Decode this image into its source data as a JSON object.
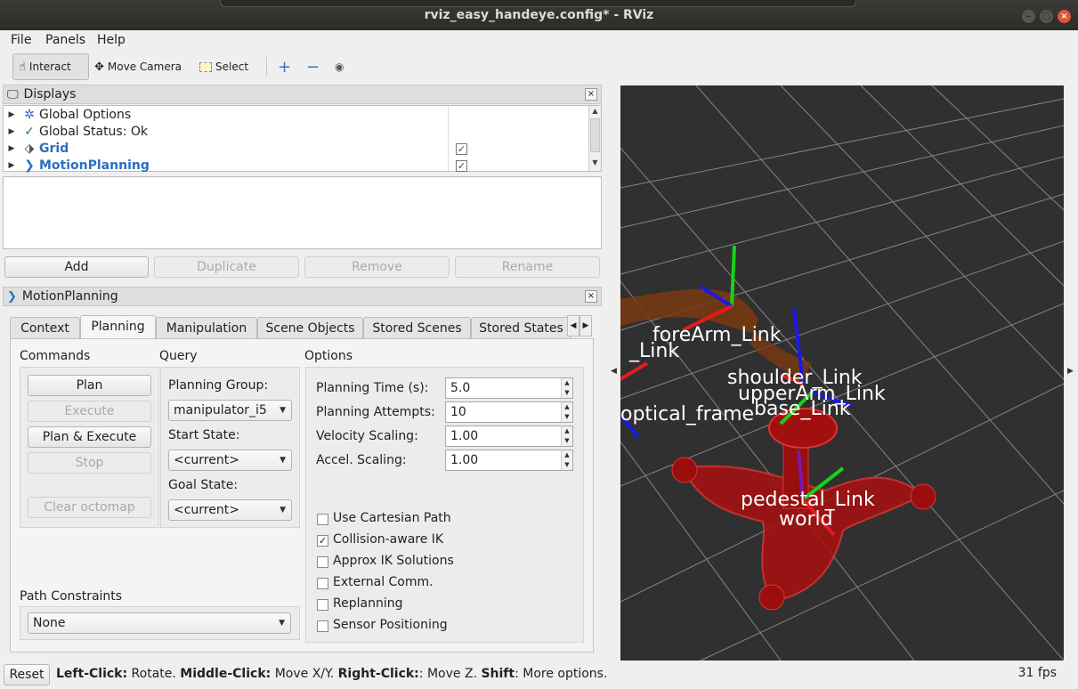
{
  "window": {
    "title": "rviz_easy_handeye.config* - RViz"
  },
  "menu": [
    "File",
    "Panels",
    "Help"
  ],
  "toolbar": {
    "interact": "Interact",
    "move_camera": "Move Camera",
    "select": "Select"
  },
  "displays": {
    "title": "Displays",
    "items": [
      {
        "label": "Global Options",
        "icon": "gear-icon"
      },
      {
        "label": "Global Status: Ok",
        "icon": "check-icon"
      },
      {
        "label": "Grid",
        "icon": "grid-icon",
        "checked": true
      },
      {
        "label": "MotionPlanning",
        "icon": "motionplanning-icon",
        "checked": true
      }
    ],
    "buttons": {
      "add": "Add",
      "duplicate": "Duplicate",
      "remove": "Remove",
      "rename": "Rename"
    }
  },
  "motion_panel": {
    "title": "MotionPlanning",
    "tabs": [
      "Context",
      "Planning",
      "Manipulation",
      "Scene Objects",
      "Stored Scenes",
      "Stored States"
    ],
    "selected_tab": "Planning",
    "commands": {
      "title": "Commands",
      "plan": "Plan",
      "execute": "Execute",
      "plan_execute": "Plan & Execute",
      "stop": "Stop",
      "clear_octomap": "Clear octomap"
    },
    "query": {
      "title": "Query",
      "planning_group_label": "Planning Group:",
      "planning_group": "manipulator_i5",
      "start_state_label": "Start State:",
      "start_state": "<current>",
      "goal_state_label": "Goal State:",
      "goal_state": "<current>"
    },
    "options": {
      "title": "Options",
      "planning_time_label": "Planning Time (s):",
      "planning_time": "5.0",
      "planning_attempts_label": "Planning Attempts:",
      "planning_attempts": "10",
      "velocity_scaling_label": "Velocity Scaling:",
      "velocity_scaling": "1.00",
      "accel_scaling_label": "Accel. Scaling:",
      "accel_scaling": "1.00",
      "checkboxes": [
        {
          "label": "Use Cartesian Path",
          "checked": false
        },
        {
          "label": "Collision-aware IK",
          "checked": true
        },
        {
          "label": "Approx IK Solutions",
          "checked": false
        },
        {
          "label": "External Comm.",
          "checked": false
        },
        {
          "label": "Replanning",
          "checked": false
        },
        {
          "label": "Sensor Positioning",
          "checked": false
        }
      ]
    },
    "path_constraints": {
      "title": "Path Constraints",
      "value": "None"
    }
  },
  "viewport": {
    "labels": [
      "foreArm_Link",
      "_Link",
      "shoulder_Link",
      "upperArm_Link",
      "base_Link",
      "optical_frame",
      "pedestal_Link",
      "world"
    ]
  },
  "statusbar": {
    "reset": "Reset",
    "parts": [
      {
        "b": "Left-Click:",
        "t": " Rotate. "
      },
      {
        "b": "Middle-Click:",
        "t": " Move X/Y. "
      },
      {
        "b": "Right-Click:",
        "t": ": Move Z. "
      },
      {
        "b": "Shift",
        "t": ": More options."
      }
    ],
    "fps": "31 fps"
  }
}
